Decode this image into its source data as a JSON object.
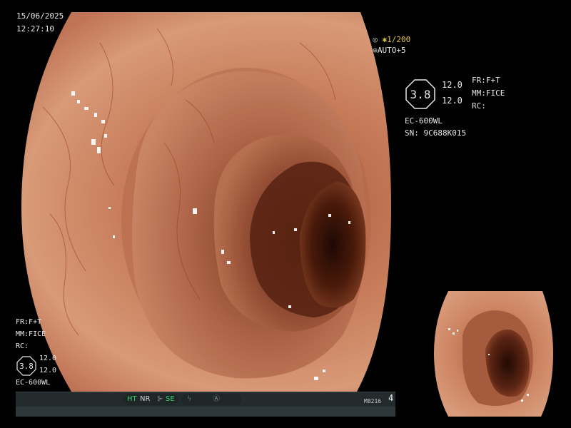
{
  "datetime": {
    "date": "15/06/2025",
    "time": "12:27:10"
  },
  "top_status": {
    "shutter": "1/200",
    "auto": "AUTO+5"
  },
  "info_right": {
    "octagon_value": "3.8",
    "values": [
      "12.0",
      "12.0"
    ],
    "settings": [
      "FR:F+T",
      "MM:FICE",
      "RC:"
    ],
    "scope_model": "EC-600WL",
    "serial": "SN: 9C688K015"
  },
  "info_left": {
    "settings": [
      "FR:F+T",
      "MM:FICE",
      "RC:"
    ],
    "octagon_value": "3.8",
    "values": [
      "12.0",
      "12.0"
    ],
    "scope_model": "EC-600WL"
  },
  "status_bar": {
    "ht": "HT",
    "nr": "NR",
    "se": "SE",
    "code": "M8216",
    "page": "4",
    "colors": {
      "active": "#2ed36a",
      "inactive": "#5e6b6d",
      "bar": "#242b2d"
    }
  },
  "icons": [
    "camera-icon",
    "scope-icon",
    "shutter-indicator-icon",
    "lightning-icon",
    "settings-dial-icon"
  ]
}
